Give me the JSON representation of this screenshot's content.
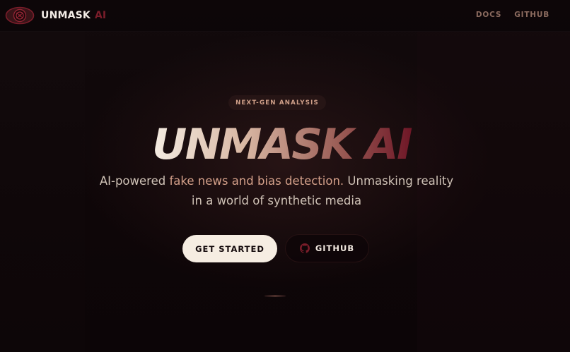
{
  "header": {
    "brand_name": "UNMASK",
    "brand_accent": "AI",
    "logo_icon": "eye-icon",
    "nav": [
      {
        "label": "DOCS"
      },
      {
        "label": "GITHUB"
      }
    ]
  },
  "hero": {
    "badge": "NEXT-GEN ANALYSIS",
    "title": "UNMASK AI",
    "subtitle_part1": "AI-powered ",
    "subtitle_highlight": "fake news and bias detection.",
    "subtitle_part2": " Unmasking reality in a world of synthetic media",
    "primary_button": "GET STARTED",
    "secondary_button": "GITHUB",
    "secondary_icon": "github-icon"
  },
  "colors": {
    "background": "#0f0709",
    "accent": "#7a1d2a",
    "highlight": "#d4a08a",
    "primary_button_bg": "#f6ede2"
  }
}
